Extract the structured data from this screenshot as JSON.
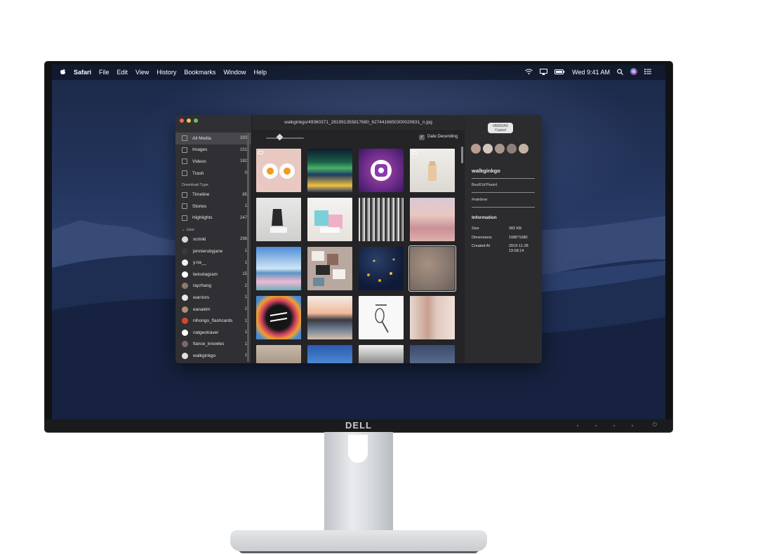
{
  "brand": "DELL",
  "menubar": {
    "apple_icon": "apple-logo-icon",
    "app": "Safari",
    "menus": [
      "File",
      "Edit",
      "View",
      "History",
      "Bookmarks",
      "Window",
      "Help"
    ],
    "clock": "Wed 9:41 AM"
  },
  "app_window": {
    "title": "walkginkgo/49360371_281991355817680_6274416650300020831_n.jpg",
    "sidebar": {
      "library": [
        {
          "label": "All Media",
          "count": "333",
          "icon": "photos-icon",
          "active": true
        },
        {
          "label": "Images",
          "count": "151",
          "icon": "image-icon"
        },
        {
          "label": "Videos",
          "count": "182",
          "icon": "video-icon"
        },
        {
          "label": "Trash",
          "count": "0",
          "icon": "trash-icon"
        }
      ],
      "download_type_header": "Download Type",
      "download_types": [
        {
          "label": "Timeline",
          "count": "85",
          "icon": "timeline-icon"
        },
        {
          "label": "Stories",
          "count": "1",
          "icon": "stories-icon"
        },
        {
          "label": "Highlights",
          "count": "247",
          "icon": "highlights-icon"
        }
      ],
      "user_header": "User",
      "users": [
        {
          "label": "scrinkl",
          "count": "296",
          "color": "#d8d8d8"
        },
        {
          "label": "jennierubyjane",
          "count": "1",
          "color": "#3a3a3e"
        },
        {
          "label": "y.na__",
          "count": "1",
          "color": "#f0f0f0"
        },
        {
          "label": "twicetagram",
          "count": "15",
          "color": "#ffffff"
        },
        {
          "label": "layzhang",
          "count": "2",
          "color": "#8a7a6a"
        },
        {
          "label": "warriors",
          "count": "1",
          "color": "#e8e8e8"
        },
        {
          "label": "eanakim",
          "count": "2",
          "color": "#b09070"
        },
        {
          "label": "nihongo_flashcards",
          "count": "1",
          "color": "#d9472b"
        },
        {
          "label": "natgeotravel",
          "count": "1",
          "color": "#ffffff"
        },
        {
          "label": "fiance_knowles",
          "count": "1",
          "color": "#7a6a6a"
        },
        {
          "label": "walkginkgo",
          "count": "1",
          "color": "#e0e0e0"
        }
      ]
    },
    "toolbar": {
      "sort_label": "Date Decending",
      "sort_check": "✓"
    },
    "info_panel": {
      "hex_button": {
        "top": "#B89DAD",
        "bottom": "Copied"
      },
      "swatch_colors": [
        "#b89d8f",
        "#d2c7bd",
        "#a8968a",
        "#8e7f78",
        "#c3b3a3"
      ],
      "username": "walkginkgo",
      "shortcode": "BsuR1dYhasH",
      "hashtag": "#rainbow",
      "info_heading": "Information",
      "fields": [
        {
          "key": "Size",
          "value": "382 KB"
        },
        {
          "key": "Dimensions",
          "value": "1080*1080"
        },
        {
          "key": "Created At",
          "value": "2019-11-28",
          "value2": "19:58:14"
        }
      ]
    }
  },
  "colors": {
    "window_bg": "#2a2a2c",
    "sidebar_bg": "#303034",
    "active_row": "#47474c",
    "traffic_close": "#ed6a5e",
    "traffic_min": "#f5bf4f",
    "traffic_max": "#62c554"
  }
}
